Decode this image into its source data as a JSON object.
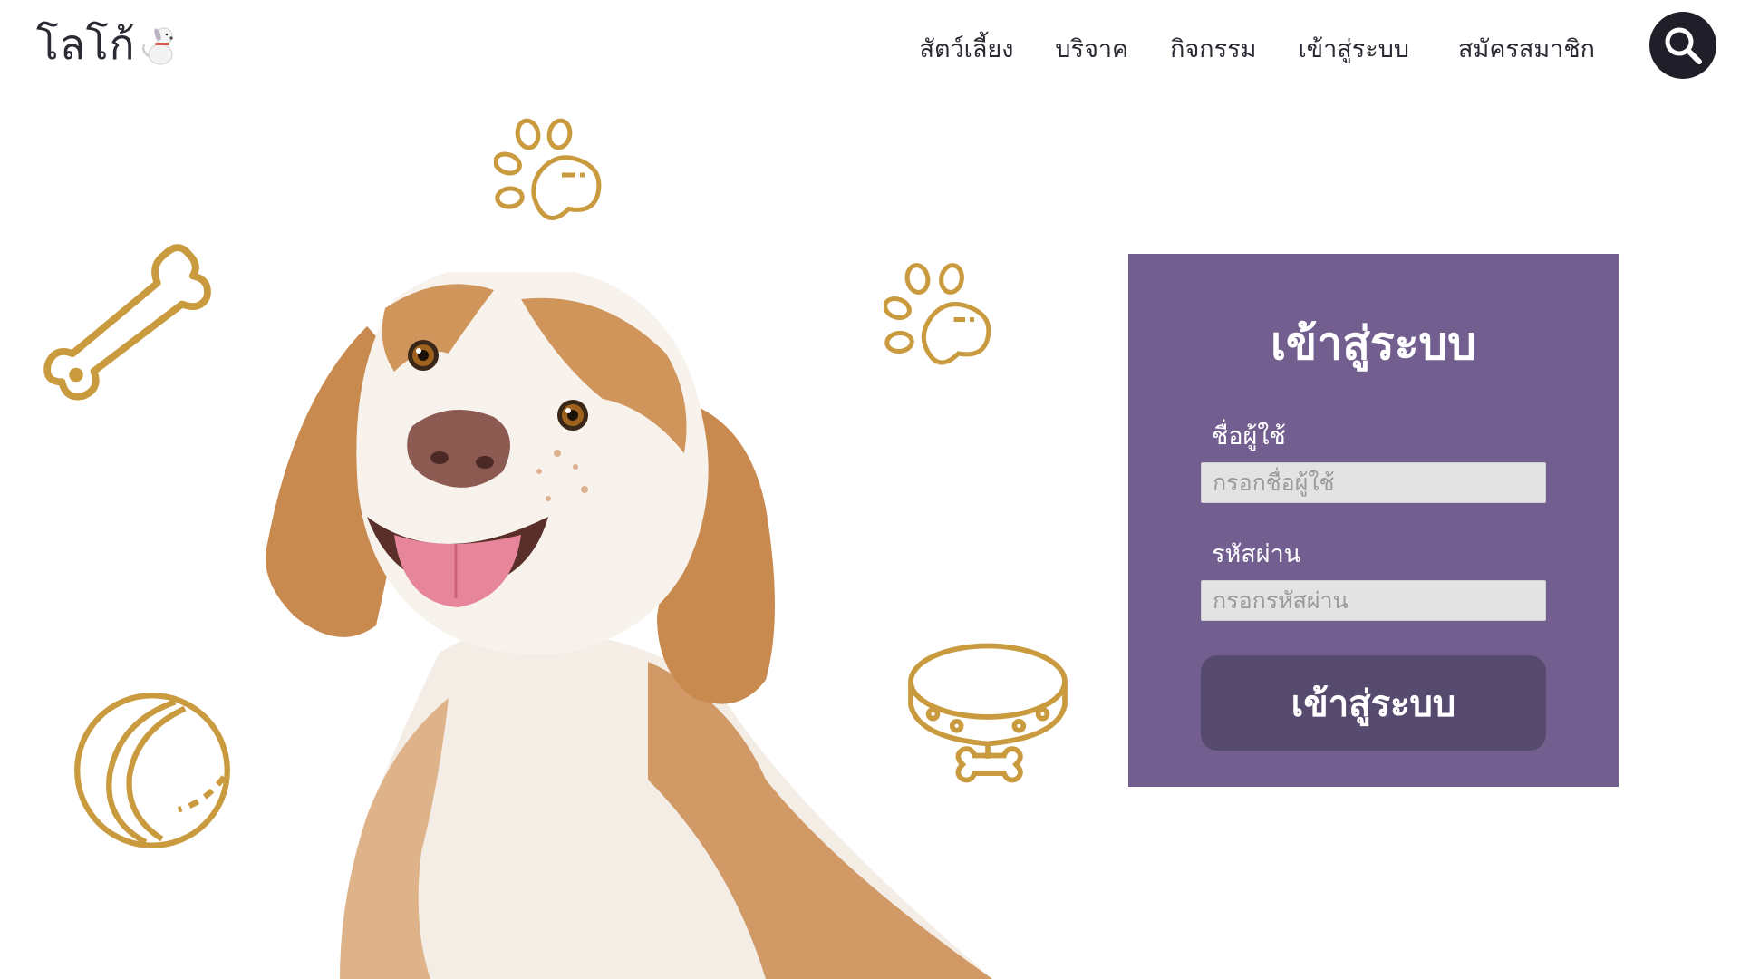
{
  "header": {
    "logo_text": "โลโก้",
    "nav": [
      {
        "label": "สัตว์เลี้ยง"
      },
      {
        "label": "บริจาค"
      },
      {
        "label": "กิจกรรม"
      },
      {
        "label": "เข้าสู่ระบบ"
      },
      {
        "label": "สมัครสมาชิก"
      }
    ]
  },
  "login": {
    "title": "เข้าสู่ระบบ",
    "username_label": "ชื่อผู้ใช้",
    "username_placeholder": "กรอกชื่อผู้ใช้",
    "username_value": "",
    "password_label": "รหัสผ่าน",
    "password_placeholder": "กรอกรหัสผ่าน",
    "password_value": "",
    "submit_label": "เข้าสู่ระบบ"
  },
  "icons": {
    "search": "search-icon",
    "logo_mascot": "dog-mascot-icon",
    "decor": [
      "paw-icon",
      "bone-icon",
      "paw-icon",
      "tennis-ball-icon",
      "dog-collar-icon"
    ]
  },
  "colors": {
    "text_dark": "#2b2a33",
    "card": "#725f90",
    "button": "#564a6e",
    "input": "#e3e3e3",
    "decor_gold": "#c99a3e",
    "dog_fur": "#c98a4f"
  }
}
